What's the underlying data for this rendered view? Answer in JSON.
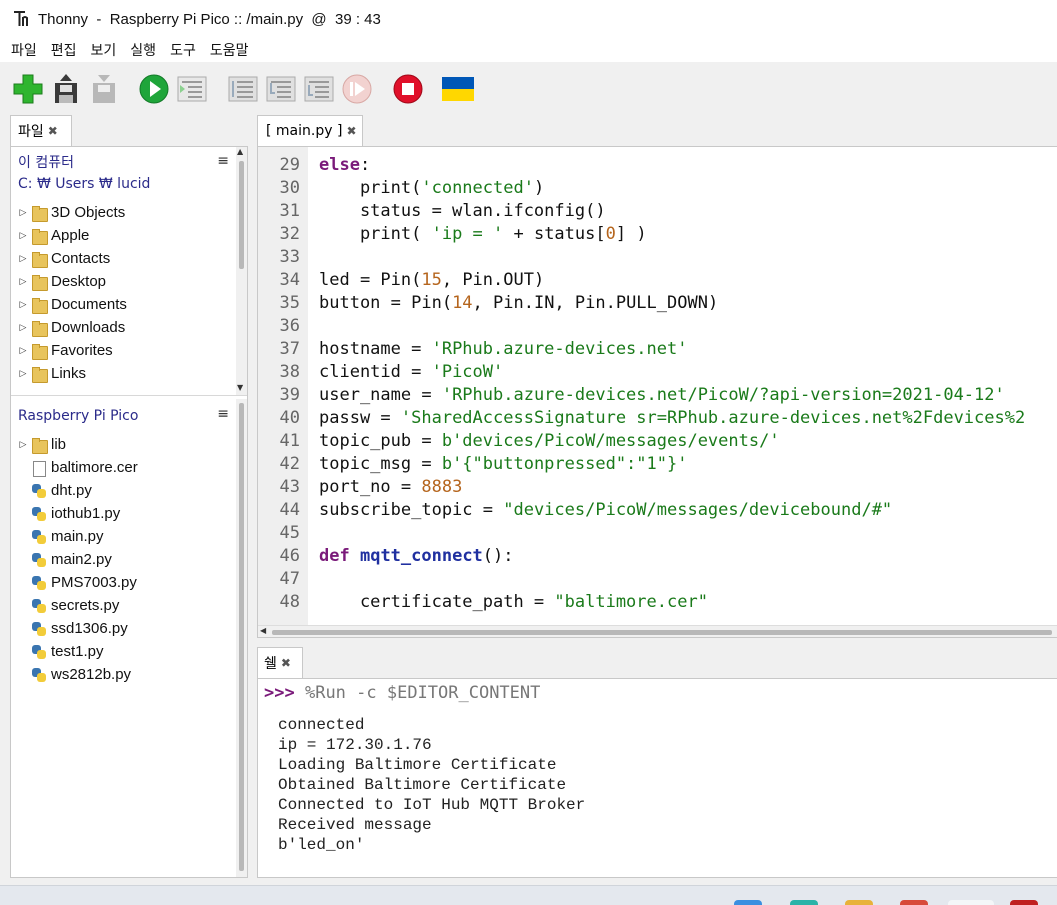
{
  "window": {
    "title": "Thonny  -  Raspberry Pi Pico :: /main.py  @  39 : 43"
  },
  "menu": [
    "파일",
    "편집",
    "보기",
    "실행",
    "도구",
    "도움말"
  ],
  "toolbar": {
    "icons": [
      "new-file-icon",
      "load-icon",
      "save-icon",
      "run-icon",
      "debug-icon",
      "step-over-icon",
      "step-into-icon",
      "step-out-icon",
      "resume-icon",
      "stop-icon",
      "ukraine-flag-icon"
    ],
    "colors": {
      "run": "#1fa53a",
      "stop": "#e0102a",
      "new": "#2fb52f",
      "flag_blue": "#0057b7",
      "flag_yellow": "#ffd700"
    }
  },
  "files_pane": {
    "tab_label": "파일",
    "computer": {
      "title": "이 컴퓨터",
      "path": "C: ₩ Users ₩ lucid",
      "items": [
        "3D Objects",
        "Apple",
        "Contacts",
        "Desktop",
        "Documents",
        "Downloads",
        "Favorites",
        "Links"
      ]
    },
    "device": {
      "title": "Raspberry Pi Pico",
      "items": [
        {
          "name": "lib",
          "type": "folder"
        },
        {
          "name": "baltimore.cer",
          "type": "file"
        },
        {
          "name": "dht.py",
          "type": "py"
        },
        {
          "name": "iothub1.py",
          "type": "py"
        },
        {
          "name": "main.py",
          "type": "py"
        },
        {
          "name": "main2.py",
          "type": "py"
        },
        {
          "name": "PMS7003.py",
          "type": "py"
        },
        {
          "name": "secrets.py",
          "type": "py"
        },
        {
          "name": "ssd1306.py",
          "type": "py"
        },
        {
          "name": "test1.py",
          "type": "py"
        },
        {
          "name": "ws2812b.py",
          "type": "py"
        }
      ]
    }
  },
  "editor": {
    "tab_label": "[ main.py ]",
    "lines": [
      {
        "n": "29",
        "tokens": [
          {
            "t": "else",
            "c": "kw"
          },
          {
            "t": ":",
            "c": ""
          }
        ]
      },
      {
        "n": "30",
        "tokens": [
          {
            "t": "    print(",
            "c": ""
          },
          {
            "t": "'connected'",
            "c": "str"
          },
          {
            "t": ")",
            "c": ""
          }
        ]
      },
      {
        "n": "31",
        "tokens": [
          {
            "t": "    status = wlan.ifconfig()",
            "c": ""
          }
        ]
      },
      {
        "n": "32",
        "tokens": [
          {
            "t": "    print( ",
            "c": ""
          },
          {
            "t": "'ip = '",
            "c": "str"
          },
          {
            "t": " + status[",
            "c": ""
          },
          {
            "t": "0",
            "c": "num"
          },
          {
            "t": "] )",
            "c": ""
          }
        ]
      },
      {
        "n": "33",
        "tokens": []
      },
      {
        "n": "34",
        "tokens": [
          {
            "t": "led = Pin(",
            "c": ""
          },
          {
            "t": "15",
            "c": "num"
          },
          {
            "t": ", Pin.OUT)",
            "c": ""
          }
        ]
      },
      {
        "n": "35",
        "tokens": [
          {
            "t": "button = Pin(",
            "c": ""
          },
          {
            "t": "14",
            "c": "num"
          },
          {
            "t": ", Pin.IN, Pin.PULL_DOWN)",
            "c": ""
          }
        ]
      },
      {
        "n": "36",
        "tokens": []
      },
      {
        "n": "37",
        "tokens": [
          {
            "t": "hostname = ",
            "c": ""
          },
          {
            "t": "'RPhub.azure-devices.net'",
            "c": "str"
          }
        ]
      },
      {
        "n": "38",
        "tokens": [
          {
            "t": "clientid = ",
            "c": ""
          },
          {
            "t": "'PicoW'",
            "c": "str"
          }
        ]
      },
      {
        "n": "39",
        "tokens": [
          {
            "t": "user_name = ",
            "c": ""
          },
          {
            "t": "'RPhub.azure-devices.net/PicoW/?api-version=2021-04-12'",
            "c": "str"
          }
        ]
      },
      {
        "n": "40",
        "tokens": [
          {
            "t": "passw = ",
            "c": ""
          },
          {
            "t": "'SharedAccessSignature sr=RPhub.azure-devices.net%2Fdevices%2",
            "c": "str"
          }
        ]
      },
      {
        "n": "41",
        "tokens": [
          {
            "t": "topic_pub = ",
            "c": ""
          },
          {
            "t": "b'devices/PicoW/messages/events/'",
            "c": "str"
          }
        ]
      },
      {
        "n": "42",
        "tokens": [
          {
            "t": "topic_msg = ",
            "c": ""
          },
          {
            "t": "b'{\"buttonpressed\":\"1\"}'",
            "c": "str"
          }
        ]
      },
      {
        "n": "43",
        "tokens": [
          {
            "t": "port_no = ",
            "c": ""
          },
          {
            "t": "8883",
            "c": "num"
          }
        ]
      },
      {
        "n": "44",
        "tokens": [
          {
            "t": "subscribe_topic = ",
            "c": ""
          },
          {
            "t": "\"devices/PicoW/messages/devicebound/#\"",
            "c": "str"
          }
        ]
      },
      {
        "n": "45",
        "tokens": []
      },
      {
        "n": "46",
        "tokens": [
          {
            "t": "def",
            "c": "kw"
          },
          {
            "t": " ",
            "c": ""
          },
          {
            "t": "mqtt_connect",
            "c": "fn"
          },
          {
            "t": "():",
            "c": ""
          }
        ]
      },
      {
        "n": "47",
        "tokens": []
      },
      {
        "n": "48",
        "tokens": [
          {
            "t": "    certificate_path = ",
            "c": ""
          },
          {
            "t": "\"baltimore.cer\"",
            "c": "str"
          }
        ]
      }
    ]
  },
  "shell": {
    "tab_label": "쉘",
    "prompt": ">>>",
    "command": "%Run -c $EDITOR_CONTENT",
    "output": [
      "connected",
      "ip = 172.30.1.76",
      "Loading Baltimore Certificate",
      "Obtained Baltimore Certificate",
      "Connected to IoT Hub MQTT Broker",
      "Received message",
      "b'led_on'"
    ]
  }
}
